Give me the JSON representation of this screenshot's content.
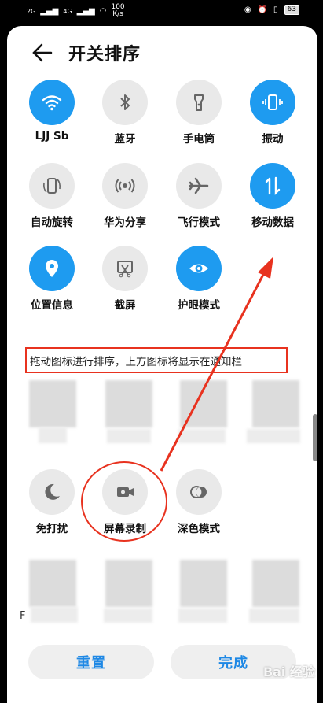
{
  "status": {
    "signal_left": "2G",
    "signal_right": "4G",
    "speed_value": "100",
    "speed_unit": "K/s",
    "battery": "63"
  },
  "header": {
    "title": "开关排序"
  },
  "active_tiles": [
    {
      "label": "LJJ Sb",
      "icon": "wifi-icon",
      "on": true
    },
    {
      "label": "蓝牙",
      "icon": "bluetooth-icon",
      "on": false
    },
    {
      "label": "手电筒",
      "icon": "flashlight-icon",
      "on": false
    },
    {
      "label": "振动",
      "icon": "vibrate-icon",
      "on": true
    },
    {
      "label": "自动旋转",
      "icon": "auto-rotate-icon",
      "on": false
    },
    {
      "label": "华为分享",
      "icon": "share-icon",
      "on": false
    },
    {
      "label": "飞行模式",
      "icon": "airplane-icon",
      "on": false
    },
    {
      "label": "移动数据",
      "icon": "mobile-data-icon",
      "on": true
    },
    {
      "label": "位置信息",
      "icon": "location-icon",
      "on": true
    },
    {
      "label": "截屏",
      "icon": "screenshot-icon",
      "on": false
    },
    {
      "label": "护眼模式",
      "icon": "eye-icon",
      "on": true
    }
  ],
  "hint": "拖动图标进行排序，上方图标将显示在通知栏",
  "inactive_tiles": [
    {
      "label": "免打扰",
      "icon": "moon-icon"
    },
    {
      "label": "屏幕录制",
      "icon": "screen-record-icon"
    },
    {
      "label": "深色模式",
      "icon": "dark-mode-icon"
    }
  ],
  "partial_label": "F",
  "buttons": {
    "reset": "重置",
    "done": "完成"
  },
  "watermark": "Bai 经验",
  "colors": {
    "accent": "#1e9bf0",
    "annotation": "#e8321f",
    "tile_off": "#e9e9e9"
  }
}
